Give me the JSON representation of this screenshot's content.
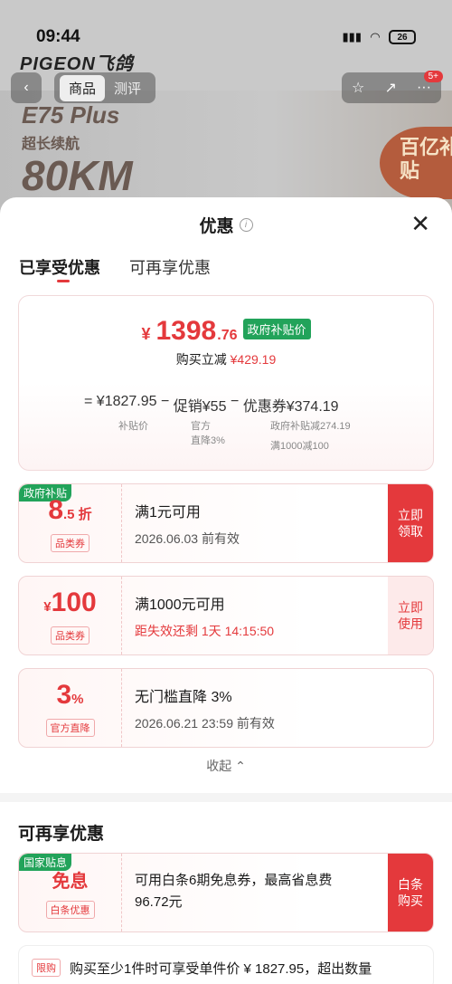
{
  "status": {
    "time": "09:44",
    "battery": "26"
  },
  "background": {
    "brand": "PIGEON飞鸽",
    "tabs": [
      "商品",
      "测评"
    ],
    "notif_badge": "5+",
    "promo_lines": [
      "E75 Plus",
      "超长续航",
      "80KM"
    ],
    "promo_badge": "百亿补贴"
  },
  "sheet": {
    "title": "优惠",
    "info_icon": "i",
    "close": "✕",
    "tabs": [
      "已享受优惠",
      "可再享优惠"
    ],
    "summary": {
      "yen": "¥",
      "price_int": "1398",
      "price_dec": ".76",
      "gov_tag": "政府补贴价",
      "reduce_label": "购买立减",
      "reduce_value": "¥429.19",
      "formula": [
        "=",
        "¥1827.95",
        "−",
        "促销¥55",
        "−",
        "优惠券¥374.19"
      ],
      "labels": {
        "subsidy_price": "补贴价",
        "official_line1": "官方",
        "official_line2": "直降3%",
        "gov_reduce": "政府补贴减274.19",
        "full_reduce": "满1000减100"
      }
    },
    "coupons": [
      {
        "corner": "政府补贴",
        "big": "8",
        "big_small": ".5 折",
        "chip": "品类券",
        "line1": "满1元可用",
        "line2": "2026.06.03 前有效",
        "cta": "立即领取"
      },
      {
        "big_prefix": "¥",
        "big": "100",
        "chip": "品类券",
        "line1": "满1000元可用",
        "line2": "距失效还剩 1天 14:15:50",
        "cta": "立即使用"
      },
      {
        "big": "3",
        "big_small": "%",
        "chip": "官方直降",
        "line1": "无门槛直降 3%",
        "line2": "2026.06.21 23:59 前有效"
      }
    ],
    "collapse": "收起 ⌃",
    "section2_title": "可再享优惠",
    "more_offer": {
      "corner": "国家贴息",
      "big": "免息",
      "chip": "白条优惠",
      "line1": "可用白条6期免息券，最高省息费",
      "line2": "96.72元",
      "cta": "白条购买"
    },
    "limit": {
      "chip": "限购",
      "text": "购买至少1件时可享受单件价 ¥ 1827.95，超出数量"
    }
  }
}
